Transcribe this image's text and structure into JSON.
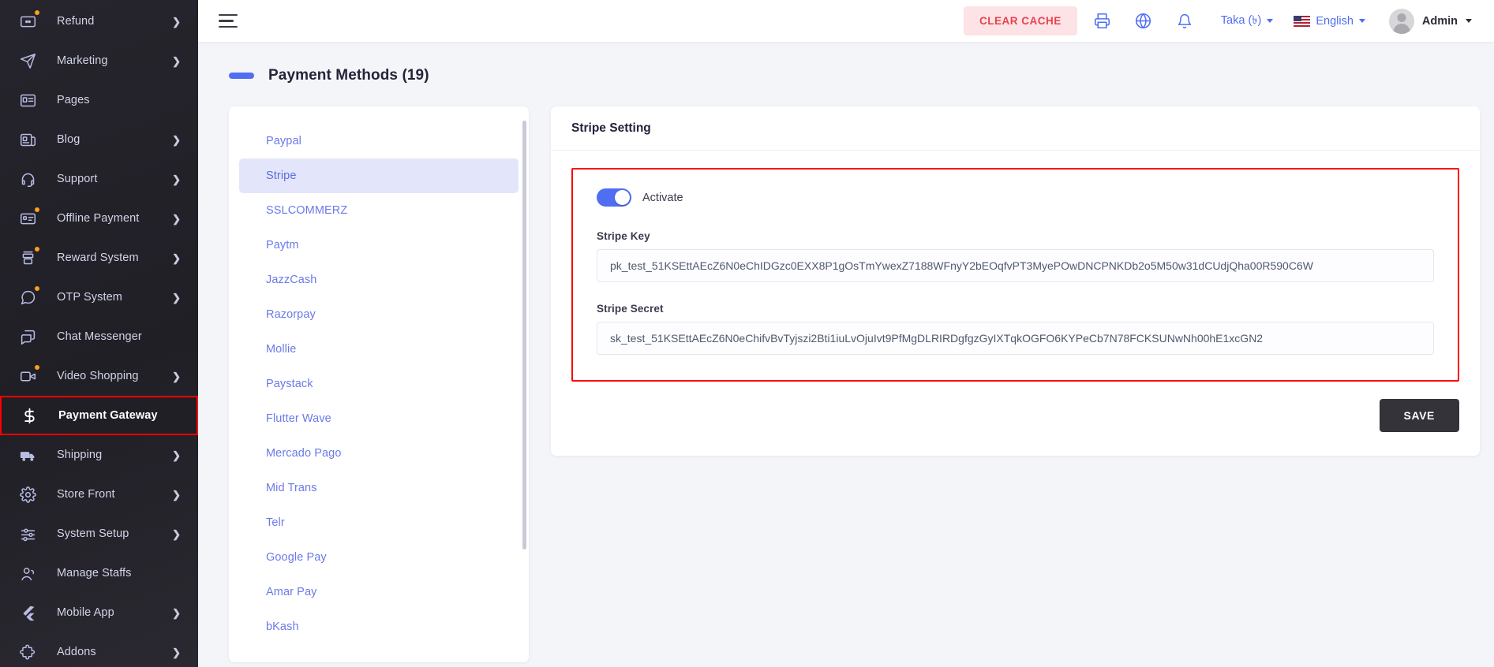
{
  "sidebar": {
    "items": [
      {
        "label": "Refund",
        "icon": "refund-card-icon",
        "caret": true,
        "dot": true,
        "active": false
      },
      {
        "label": "Marketing",
        "icon": "paper-plane-icon",
        "caret": true,
        "dot": false,
        "active": false
      },
      {
        "label": "Pages",
        "icon": "page-card-icon",
        "caret": false,
        "dot": false,
        "active": false
      },
      {
        "label": "Blog",
        "icon": "blog-icon",
        "caret": true,
        "dot": false,
        "active": false
      },
      {
        "label": "Support",
        "icon": "headset-icon",
        "caret": true,
        "dot": false,
        "active": false
      },
      {
        "label": "Offline Payment",
        "icon": "offline-card-icon",
        "caret": true,
        "dot": true,
        "active": false
      },
      {
        "label": "Reward System",
        "icon": "reward-stack-icon",
        "caret": true,
        "dot": true,
        "active": false
      },
      {
        "label": "OTP System",
        "icon": "chat-bubble-icon",
        "caret": true,
        "dot": true,
        "active": false
      },
      {
        "label": "Chat Messenger",
        "icon": "chat-multi-icon",
        "caret": false,
        "dot": false,
        "active": false
      },
      {
        "label": "Video Shopping",
        "icon": "video-camera-icon",
        "caret": true,
        "dot": true,
        "active": false
      },
      {
        "label": "Payment Gateway",
        "icon": "dollar-icon",
        "caret": false,
        "dot": false,
        "active": true
      },
      {
        "label": "Shipping",
        "icon": "truck-icon",
        "caret": true,
        "dot": false,
        "active": false
      },
      {
        "label": "Store Front",
        "icon": "gear-icon",
        "caret": true,
        "dot": false,
        "active": false
      },
      {
        "label": "System Setup",
        "icon": "sliders-icon",
        "caret": true,
        "dot": false,
        "active": false
      },
      {
        "label": "Manage Staffs",
        "icon": "users-icon",
        "caret": false,
        "dot": false,
        "active": false
      },
      {
        "label": "Mobile App",
        "icon": "flutter-icon",
        "caret": true,
        "dot": false,
        "active": false
      },
      {
        "label": "Addons",
        "icon": "puzzle-icon",
        "caret": true,
        "dot": false,
        "active": false
      }
    ]
  },
  "topbar": {
    "menu_icon": "hamburger-icon",
    "clear_cache_label": "CLEAR CACHE",
    "print_icon": "printer-icon",
    "globe_icon": "globe-icon",
    "bell_icon": "bell-icon",
    "currency": "Taka (৳)",
    "language": "English",
    "user_name": "Admin",
    "colors": {
      "accent": "#4f6ef2",
      "clear_cache_bg": "#fde3e5",
      "clear_cache_text": "#e8414f"
    }
  },
  "page": {
    "title": "Payment Methods (19)"
  },
  "methods": {
    "items": [
      {
        "label": "Paypal",
        "selected": false
      },
      {
        "label": "Stripe",
        "selected": true
      },
      {
        "label": "SSLCOMMERZ",
        "selected": false
      },
      {
        "label": "Paytm",
        "selected": false
      },
      {
        "label": "JazzCash",
        "selected": false
      },
      {
        "label": "Razorpay",
        "selected": false
      },
      {
        "label": "Mollie",
        "selected": false
      },
      {
        "label": "Paystack",
        "selected": false
      },
      {
        "label": "Flutter Wave",
        "selected": false
      },
      {
        "label": "Mercado Pago",
        "selected": false
      },
      {
        "label": "Mid Trans",
        "selected": false
      },
      {
        "label": "Telr",
        "selected": false
      },
      {
        "label": "Google Pay",
        "selected": false
      },
      {
        "label": "Amar Pay",
        "selected": false
      },
      {
        "label": "bKash",
        "selected": false
      }
    ]
  },
  "setting": {
    "heading": "Stripe Setting",
    "activate_label": "Activate",
    "activate_on": true,
    "key_label": "Stripe Key",
    "key_value": "pk_test_51KSEttAEcZ6N0eChIDGzc0EXX8P1gOsTmYwexZ7188WFnyY2bEOqfvPT3MyePOwDNCPNKDb2o5M50w31dCUdjQha00R590C6W",
    "secret_label": "Stripe Secret",
    "secret_value": "sk_test_51KSEttAEcZ6N0eChifvBvTyjszi2Bti1iuLvOjuIvt9PfMgDLRIRDgfgzGyIXTqkOGFO6KYPeCb7N78FCKSUNwNh00hE1xcGN2",
    "save_label": "SAVE",
    "highlight_color": "#fe0000"
  }
}
